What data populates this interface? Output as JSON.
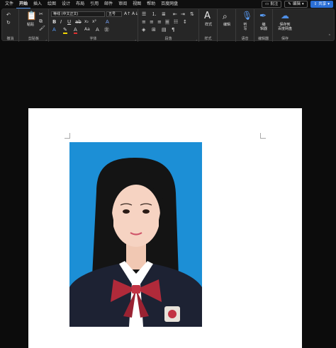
{
  "menu": {
    "tabs": [
      "文件",
      "开始",
      "插入",
      "绘图",
      "设计",
      "布局",
      "引用",
      "邮件",
      "审阅",
      "视图",
      "帮助",
      "百度网盘"
    ],
    "active_tab": "开始",
    "comment_btn": "批注",
    "edit_btn": "编辑",
    "share_btn": "共享"
  },
  "ribbon": {
    "undo_label": "撤消",
    "clipboard": {
      "paste": "粘贴",
      "label": "剪贴板"
    },
    "font": {
      "name": "等线 (中文正文)",
      "size": "五号",
      "label": "字体",
      "clear": "A",
      "font_color": "#e03030",
      "highlight": "#f2d600"
    },
    "paragraph": {
      "label": "段落"
    },
    "styles": {
      "button": "样式",
      "label": "样式"
    },
    "editing": {
      "button": "编辑",
      "label": ""
    },
    "voice": {
      "button_line1": "听",
      "button_line2": "写",
      "label": "语音"
    },
    "editor": {
      "button_line1": "编",
      "button_line2": "辑器",
      "label": "编辑器"
    },
    "save": {
      "button_line1": "保存到",
      "button_line2": "百度网盘",
      "label": "保存"
    }
  },
  "document": {
    "photo_bg": "#1c8fd6"
  }
}
